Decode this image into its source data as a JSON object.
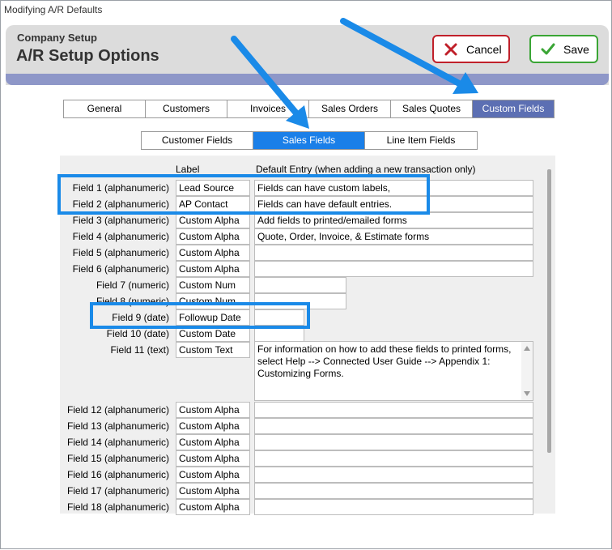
{
  "window": {
    "title": "Modifying A/R Defaults"
  },
  "header": {
    "company": "Company Setup",
    "title": "A/R Setup Options"
  },
  "buttons": {
    "cancel": "Cancel",
    "save": "Save"
  },
  "main_tabs": [
    "General",
    "Customers",
    "Invoices",
    "Sales Orders",
    "Sales Quotes",
    "Custom Fields"
  ],
  "sub_tabs": [
    "Customer Fields",
    "Sales Fields",
    "Line Item Fields"
  ],
  "columns": {
    "label": "Label",
    "default": "Default Entry (when adding a new transaction only)"
  },
  "fields": [
    {
      "name": "Field 1 (alphanumeric)",
      "label": "Lead Source",
      "default": "Fields can have custom labels,"
    },
    {
      "name": "Field 2 (alphanumeric)",
      "label": "AP Contact",
      "default": "Fields can have default entries."
    },
    {
      "name": "Field 3 (alphanumeric)",
      "label": "Custom Alpha",
      "default": "Add fields to printed/emailed forms"
    },
    {
      "name": "Field 4 (alphanumeric)",
      "label": "Custom Alpha",
      "default": "Quote, Order, Invoice, & Estimate forms"
    },
    {
      "name": "Field 5 (alphanumeric)",
      "label": "Custom Alpha",
      "default": ""
    },
    {
      "name": "Field 6 (alphanumeric)",
      "label": "Custom Alpha",
      "default": ""
    },
    {
      "name": "Field 7 (numeric)",
      "label": "Custom Num",
      "default": ""
    },
    {
      "name": "Field 8 (numeric)",
      "label": "Custom Num",
      "default": ""
    },
    {
      "name": "Field 9 (date)",
      "label": "Followup Date",
      "default": ""
    },
    {
      "name": "Field 10 (date)",
      "label": "Custom Date",
      "default": ""
    },
    {
      "name": "Field 11 (text)",
      "label": "Custom Text",
      "default": "For information on how to add these fields to printed forms, select Help --> Connected User Guide --> Appendix 1: Customizing Forms."
    },
    {
      "name": "Field 12 (alphanumeric)",
      "label": "Custom Alpha",
      "default": ""
    },
    {
      "name": "Field 13 (alphanumeric)",
      "label": "Custom Alpha",
      "default": ""
    },
    {
      "name": "Field 14 (alphanumeric)",
      "label": "Custom Alpha",
      "default": ""
    },
    {
      "name": "Field 15 (alphanumeric)",
      "label": "Custom Alpha",
      "default": ""
    },
    {
      "name": "Field 16 (alphanumeric)",
      "label": "Custom Alpha",
      "default": ""
    },
    {
      "name": "Field 17 (alphanumeric)",
      "label": "Custom Alpha",
      "default": ""
    },
    {
      "name": "Field 18 (alphanumeric)",
      "label": "Custom Alpha",
      "default": ""
    }
  ],
  "icons": {
    "cancel": "x-icon",
    "save": "check-icon"
  },
  "colors": {
    "active_tab": "#5c6fb3",
    "active_subtab": "#1a7fe8",
    "highlight": "#1a8ae8",
    "cancel_red": "#c0202a",
    "save_green": "#3aa535"
  }
}
